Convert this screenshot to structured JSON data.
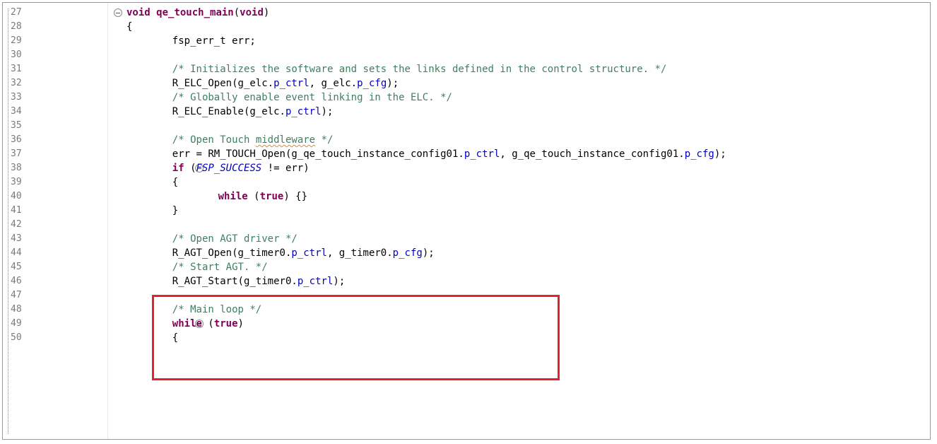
{
  "editor": {
    "lines": [
      {
        "no": "27",
        "fold": true,
        "indent": 0,
        "parts": [
          {
            "t": "void",
            "c": "kw"
          },
          {
            "t": " "
          },
          {
            "t": "qe_touch_main",
            "c": "kw"
          },
          {
            "t": "("
          },
          {
            "t": "void",
            "c": "kw"
          },
          {
            "t": ")"
          }
        ]
      },
      {
        "no": "28",
        "indent": 0,
        "parts": [
          {
            "t": "{"
          }
        ]
      },
      {
        "no": "29",
        "indent": 4,
        "parts": [
          {
            "t": "fsp_err_t err;"
          }
        ]
      },
      {
        "no": "30",
        "indent": 0,
        "parts": []
      },
      {
        "no": "31",
        "indent": 4,
        "parts": [
          {
            "t": "/* Initializes the software and sets the links defined in the control structure. */",
            "c": "cm"
          }
        ]
      },
      {
        "no": "32",
        "indent": 4,
        "parts": [
          {
            "t": "R_ELC_Open(g_elc."
          },
          {
            "t": "p_ctrl",
            "c": "fld"
          },
          {
            "t": ", g_elc."
          },
          {
            "t": "p_cfg",
            "c": "fld"
          },
          {
            "t": ");"
          }
        ]
      },
      {
        "no": "33",
        "indent": 4,
        "parts": [
          {
            "t": "/* Globally enable event linking in the ELC. */",
            "c": "cm"
          }
        ]
      },
      {
        "no": "34",
        "indent": 4,
        "parts": [
          {
            "t": "R_ELC_Enable(g_elc."
          },
          {
            "t": "p_ctrl",
            "c": "fld"
          },
          {
            "t": ");"
          }
        ]
      },
      {
        "no": "35",
        "indent": 0,
        "parts": []
      },
      {
        "no": "36",
        "indent": 4,
        "parts": [
          {
            "t": "/* Open Touch ",
            "c": "cm"
          },
          {
            "t": "middleware",
            "c": "cm squig"
          },
          {
            "t": " */",
            "c": "cm"
          }
        ]
      },
      {
        "no": "37",
        "indent": 4,
        "parts": [
          {
            "t": "err = RM_TOUCH_Open(g_qe_touch_instance_config01."
          },
          {
            "t": "p_ctrl",
            "c": "fld"
          },
          {
            "t": ", g_qe_touch_instance_config01."
          },
          {
            "t": "p_cfg",
            "c": "fld"
          },
          {
            "t": ");"
          }
        ]
      },
      {
        "no": "38",
        "fold": true,
        "indent": 4,
        "parts": [
          {
            "t": "if",
            "c": "kw"
          },
          {
            "t": " ("
          },
          {
            "t": "FSP_SUCCESS",
            "c": "mac"
          },
          {
            "t": " != err)"
          }
        ]
      },
      {
        "no": "39",
        "indent": 4,
        "parts": [
          {
            "t": "{"
          }
        ]
      },
      {
        "no": "40",
        "indent": 8,
        "parts": [
          {
            "t": "while",
            "c": "kw"
          },
          {
            "t": " ("
          },
          {
            "t": "true",
            "c": "kw"
          },
          {
            "t": ") {}"
          }
        ]
      },
      {
        "no": "41",
        "indent": 4,
        "parts": [
          {
            "t": "}"
          }
        ]
      },
      {
        "no": "42",
        "indent": 0,
        "parts": []
      },
      {
        "no": "43",
        "indent": 4,
        "parts": [
          {
            "t": "/* Open AGT driver */",
            "c": "cm"
          }
        ]
      },
      {
        "no": "44",
        "indent": 4,
        "parts": [
          {
            "t": "R_AGT_Open(g_timer0."
          },
          {
            "t": "p_ctrl",
            "c": "fld"
          },
          {
            "t": ", g_timer0."
          },
          {
            "t": "p_cfg",
            "c": "fld"
          },
          {
            "t": ");"
          }
        ]
      },
      {
        "no": "45",
        "indent": 4,
        "parts": [
          {
            "t": "/* Start AGT. */",
            "c": "cm"
          }
        ]
      },
      {
        "no": "46",
        "indent": 4,
        "parts": [
          {
            "t": "R_AGT_Start(g_timer0."
          },
          {
            "t": "p_ctrl",
            "c": "fld"
          },
          {
            "t": ");"
          }
        ]
      },
      {
        "no": "47",
        "indent": 0,
        "parts": []
      },
      {
        "no": "48",
        "indent": 4,
        "parts": [
          {
            "t": "/* Main loop */",
            "c": "cm"
          }
        ]
      },
      {
        "no": "49",
        "fold": true,
        "indent": 4,
        "parts": [
          {
            "t": "while",
            "c": "kw"
          },
          {
            "t": " ("
          },
          {
            "t": "true",
            "c": "kw"
          },
          {
            "t": ")"
          }
        ]
      },
      {
        "no": "50",
        "indent": 4,
        "parts": [
          {
            "t": "{"
          }
        ]
      }
    ]
  },
  "colors": {
    "keyword": "#7f0055",
    "comment": "#3f7f5f",
    "field": "#0000c0",
    "highlight_box": "#e0242c"
  },
  "icons": {
    "fold": "collapse-fold-icon"
  }
}
